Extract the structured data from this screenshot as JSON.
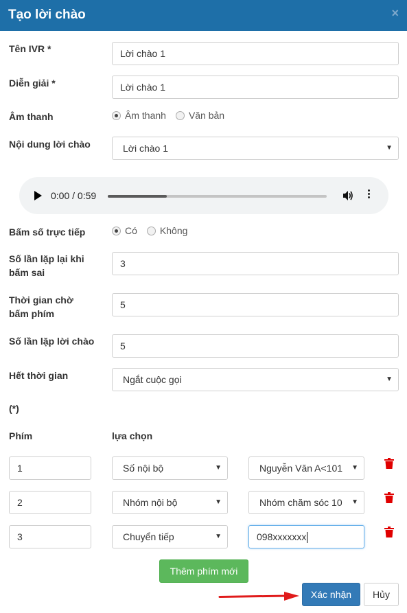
{
  "dialog": {
    "title": "Tạo lời chào",
    "close_glyph": "×"
  },
  "fields": {
    "ivr_name": {
      "label": "Tên IVR *",
      "value": "Lời chào 1"
    },
    "description": {
      "label": "Diễn giải *",
      "value": "Lời chào 1"
    },
    "sound": {
      "label": "Âm thanh",
      "options": [
        "Âm thanh",
        "Văn bản"
      ],
      "selected": "Âm thanh"
    },
    "greeting_content": {
      "label": "Nội dung lời chào",
      "value": "Lời chào 1"
    },
    "audio": {
      "time": "0:00 / 0:59",
      "progress_fraction": 0.27
    },
    "direct_dial": {
      "label": "Bấm số trực tiếp",
      "options": [
        "Có",
        "Không"
      ],
      "selected": "Có"
    },
    "retry_wrong": {
      "label_line1": "Số lần lặp lại khi",
      "label_line2": "bấm sai",
      "value": "3"
    },
    "wait_time": {
      "label_line1": "Thời gian chờ",
      "label_line2": "bấm phím",
      "value": "5"
    },
    "repeat_greeting": {
      "label": "Số lần lặp lời chào",
      "value": "5"
    },
    "timeout": {
      "label": "Hết thời gian",
      "value": "Ngắt cuộc gọi"
    }
  },
  "keys_section": {
    "note": "(*)",
    "col_key": "Phím",
    "col_choice": "lựa chọn",
    "rows": [
      {
        "key": "1",
        "choice": "Số nội bộ",
        "target": "Nguyễn Văn A<101"
      },
      {
        "key": "2",
        "choice": "Nhóm nội bộ",
        "target": "Nhóm chăm sóc 10"
      },
      {
        "key": "3",
        "choice": "Chuyển tiếp",
        "target": "098xxxxxxx"
      }
    ]
  },
  "buttons": {
    "add_key": "Thêm phím mới",
    "confirm": "Xác nhận",
    "cancel": "Hủy"
  },
  "colors": {
    "header": "#1e6fa8",
    "add_button": "#5cb85c",
    "confirm_button": "#337ab7",
    "delete_icon": "#e00000",
    "arrow": "#e01b1b"
  },
  "icons": {
    "close": "close-icon",
    "delete": "trash-icon",
    "play": "play-icon",
    "volume": "volume-icon",
    "more": "more-vertical-icon",
    "arrow": "arrow-right-icon"
  }
}
